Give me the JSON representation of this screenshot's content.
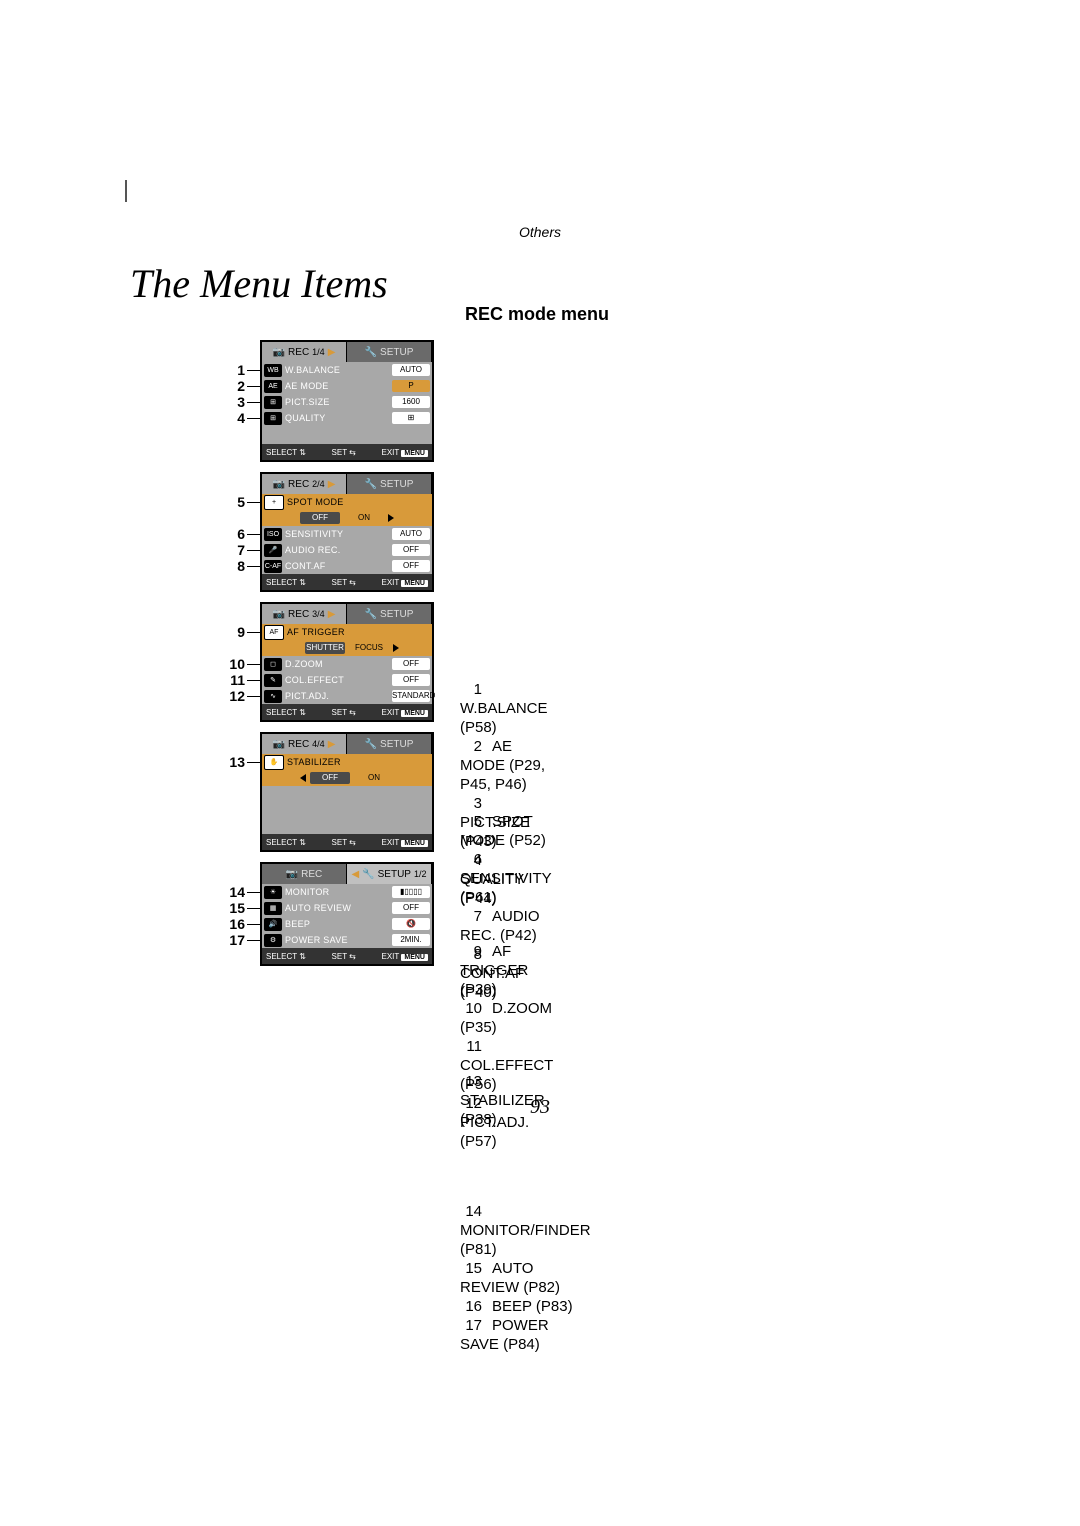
{
  "page": {
    "chapter": "Others",
    "title": "The Menu Items",
    "section": "REC mode menu",
    "number": "93"
  },
  "nav": {
    "select": "SELECT",
    "set": "SET",
    "exit": "EXIT",
    "menu": "MENU"
  },
  "tabs": {
    "rec": "REC",
    "setup": "SETUP"
  },
  "menus": [
    {
      "page": "1/4",
      "items": [
        {
          "n": 1,
          "icon": "WB",
          "label": "W.BALANCE",
          "value": "AUTO",
          "valueStyle": "light"
        },
        {
          "n": 2,
          "icon": "AE",
          "label": "AE MODE",
          "value": "P",
          "valueStyle": "orange"
        },
        {
          "n": 3,
          "icon": "⊞",
          "label": "PICT.SIZE",
          "value": "1600",
          "valueStyle": "light"
        },
        {
          "n": 4,
          "icon": "⊞",
          "label": "QUALITY",
          "value": "⊞",
          "valueStyle": "light"
        }
      ]
    },
    {
      "page": "2/4",
      "special": "spot",
      "items": [
        {
          "n": 5,
          "icon": "+",
          "label": "SPOT MODE",
          "pills": [
            "OFF",
            "ON"
          ]
        },
        {
          "n": 6,
          "icon": "ISO",
          "label": "SENSITIVITY",
          "value": "AUTO",
          "valueStyle": "light"
        },
        {
          "n": 7,
          "icon": "🎤",
          "label": "AUDIO REC.",
          "value": "OFF",
          "valueStyle": "light"
        },
        {
          "n": 8,
          "icon": "C-AF",
          "label": "CONT.AF",
          "value": "OFF",
          "valueStyle": "light"
        }
      ]
    },
    {
      "page": "3/4",
      "special": "aftrigger",
      "items": [
        {
          "n": 9,
          "icon": "AF",
          "label": "AF TRIGGER",
          "pills": [
            "SHUTTER",
            "FOCUS"
          ]
        },
        {
          "n": 10,
          "icon": "◻",
          "label": "D.ZOOM",
          "value": "OFF",
          "valueStyle": "light"
        },
        {
          "n": 11,
          "icon": "✎",
          "label": "COL.EFFECT",
          "value": "OFF",
          "valueStyle": "light"
        },
        {
          "n": 12,
          "icon": "∿",
          "label": "PICT.ADJ.",
          "value": "STANDARD",
          "valueStyle": "light"
        }
      ]
    },
    {
      "page": "4/4",
      "special": "stabilizer",
      "items": [
        {
          "n": 13,
          "icon": "✋",
          "label": "STABILIZER",
          "pills": [
            "OFF",
            "ON"
          ]
        }
      ]
    },
    {
      "page": "1/2",
      "tabFocus": "setup",
      "items": [
        {
          "n": 14,
          "icon": "☀",
          "label": "MONITOR",
          "value": "▮▯▯▯▯",
          "valueStyle": "light"
        },
        {
          "n": 15,
          "icon": "▦",
          "label": "AUTO REVIEW",
          "value": "OFF",
          "valueStyle": "light"
        },
        {
          "n": 16,
          "icon": "🔊",
          "label": "BEEP",
          "value": "🔇",
          "valueStyle": "light"
        },
        {
          "n": 17,
          "icon": "⚙",
          "label": "POWER SAVE",
          "value": "2MIN.",
          "valueStyle": "light"
        }
      ]
    }
  ],
  "defs": [
    {
      "g": 0,
      "n": 1,
      "text": "W.BALANCE (P58)"
    },
    {
      "g": 0,
      "n": 2,
      "text": "AE MODE (P29, P45, P46)"
    },
    {
      "g": 0,
      "n": 3,
      "text": "PICT.SIZE (P43)"
    },
    {
      "g": 0,
      "n": 4,
      "text": "QUALITY (P44)"
    },
    {
      "g": 1,
      "n": 5,
      "text": "SPOT MODE (P52)"
    },
    {
      "g": 1,
      "n": 6,
      "text": "SENSITIVITY (P61)"
    },
    {
      "g": 1,
      "n": 7,
      "text": "AUDIO REC. (P42)"
    },
    {
      "g": 1,
      "n": 8,
      "text": "CONT.AF (P40)"
    },
    {
      "g": 2,
      "n": 9,
      "text": "AF TRIGGER (P39)"
    },
    {
      "g": 2,
      "n": 10,
      "text": "D.ZOOM (P35)"
    },
    {
      "g": 2,
      "n": 11,
      "text": "COL.EFFECT (P56)"
    },
    {
      "g": 2,
      "n": 12,
      "text": "PICT.ADJ. (P57)"
    },
    {
      "g": 3,
      "n": 13,
      "text": "STABILIZER (P38)"
    },
    {
      "g": 4,
      "n": 14,
      "text": "MONITOR/FINDER (P81)"
    },
    {
      "g": 4,
      "n": 15,
      "text": "AUTO REVIEW (P82)"
    },
    {
      "g": 4,
      "n": 16,
      "text": "BEEP (P83)"
    },
    {
      "g": 4,
      "n": 17,
      "text": "POWER SAVE (P84)"
    }
  ]
}
